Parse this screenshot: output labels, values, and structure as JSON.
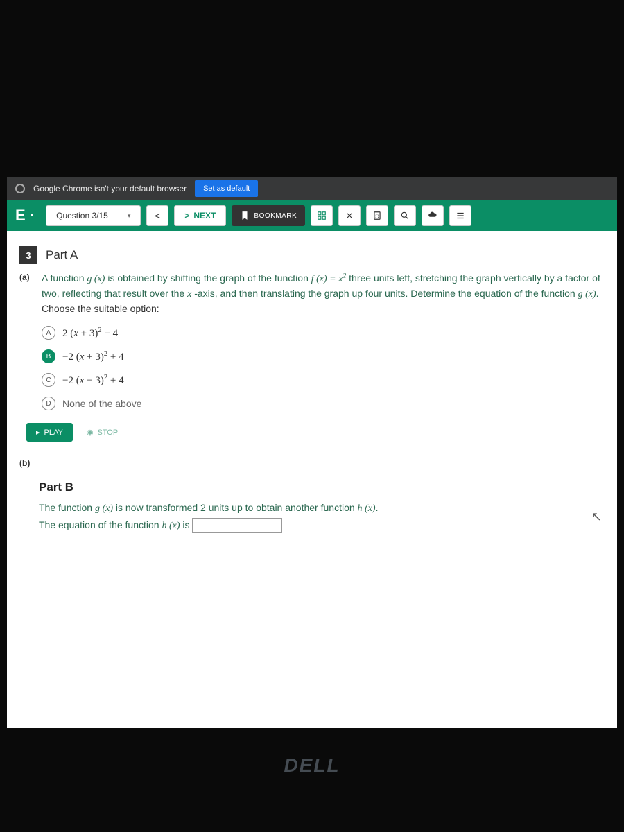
{
  "chrome_bar": {
    "message": "Google Chrome isn't your default browser",
    "button": "Set as default"
  },
  "quiz_bar": {
    "logo": "E ·",
    "question_label": "Question 3/15",
    "next": "NEXT",
    "bookmark": "BOOKMARK"
  },
  "question": {
    "number": "3",
    "part_a_title": "Part A",
    "sub_a": "(a)",
    "text_1": "A function ",
    "text_2": " is obtained by shifting the graph of the function ",
    "text_3": " three units left, stretching the graph vertically by a factor of two, reflecting that result over the ",
    "text_4": " -axis, and then translating the graph up four units. Determine the equation of the function ",
    "text_5": ".",
    "choose": "Choose the suitable option:",
    "options": {
      "a": {
        "letter": "A",
        "math": "2 (x + 3)² + 4"
      },
      "b": {
        "letter": "B",
        "math": "−2 (x + 3)² + 4"
      },
      "c": {
        "letter": "C",
        "math": "−2 (x − 3)² + 4"
      },
      "d": {
        "letter": "D",
        "text": "None of the above"
      }
    },
    "play": "PLAY",
    "stop": "STOP",
    "sub_b": "(b)",
    "part_b_title": "Part B",
    "part_b_1": "The function  ",
    "part_b_2": " is now transformed 2 units up to obtain another function ",
    "part_b_3": ".",
    "part_b_4": "The equation of the function ",
    "part_b_5": " is"
  },
  "dell": "DELL"
}
